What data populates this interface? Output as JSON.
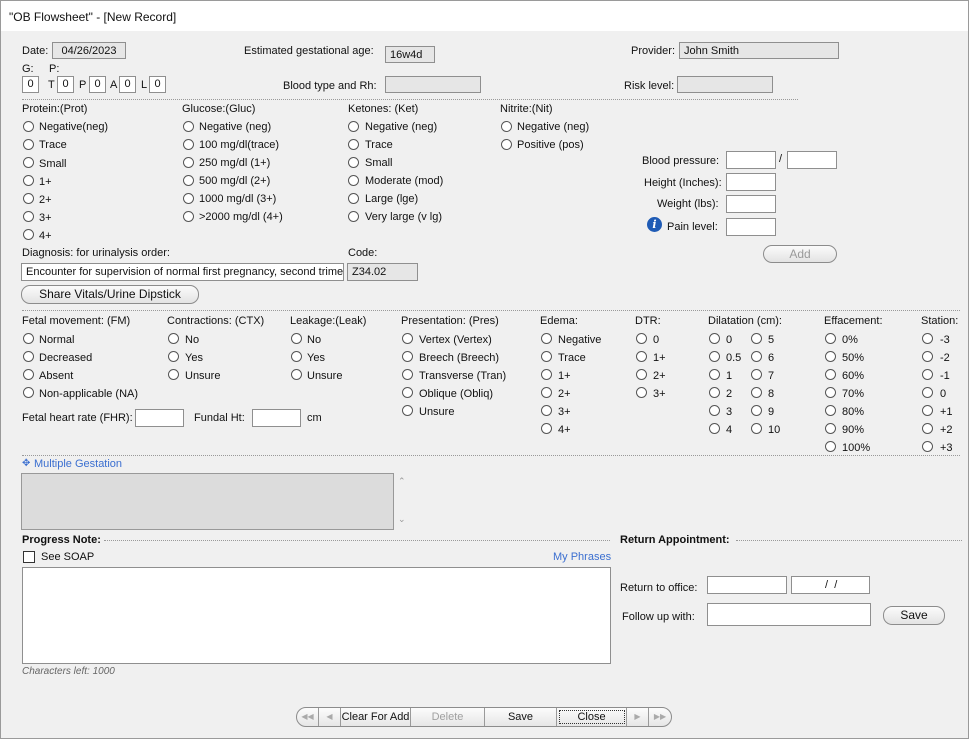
{
  "window": {
    "title": "\"OB Flowsheet\" - [New Record]"
  },
  "header": {
    "date_label": "Date:",
    "date_value": "04/26/2023",
    "ega_label": "Estimated gestational age:",
    "ega_value": "16w4d",
    "provider_label": "Provider:",
    "provider_value": "John Smith",
    "g_label": "G:",
    "g_value": "0",
    "p_label": "P:",
    "t_label": "T",
    "t_value": "0",
    "p2_label": "P",
    "p2_value": "0",
    "a_label": "A",
    "a_value": "0",
    "l_label": "L",
    "l_value": "0",
    "blood_type_label": "Blood type and Rh:",
    "risk_label": "Risk level:"
  },
  "urinalysis": {
    "protein": {
      "title": "Protein:(Prot)",
      "options": [
        "Negative(neg)",
        "Trace",
        "Small",
        "1+",
        "2+",
        "3+",
        "4+"
      ]
    },
    "glucose": {
      "title": "Glucose:(Gluc)",
      "options": [
        "Negative (neg)",
        "100 mg/dl(trace)",
        "250 mg/dl (1+)",
        "500 mg/dl (2+)",
        "1000 mg/dl (3+)",
        ">2000 mg/dl (4+)"
      ]
    },
    "ketones": {
      "title": "Ketones: (Ket)",
      "options": [
        "Negative (neg)",
        "Trace",
        "Small",
        "Moderate (mod)",
        "Large (lge)",
        "Very large (v lg)"
      ]
    },
    "nitrite": {
      "title": "Nitrite:(Nit)",
      "options": [
        "Negative (neg)",
        "Positive (pos)"
      ]
    }
  },
  "vitals": {
    "bp_label": "Blood pressure:",
    "bp_sep": "/",
    "height_label": "Height (Inches):",
    "weight_label": "Weight (lbs):",
    "pain_label": "Pain level:",
    "add_label": "Add"
  },
  "diagnosis": {
    "label": "Diagnosis: for urinalysis order:",
    "value": "Encounter for supervision of normal first pregnancy, second trimester",
    "code_label": "Code:",
    "code_value": "Z34.02",
    "share_label": "Share Vitals/Urine Dipstick"
  },
  "fetal": {
    "movement": {
      "title": "Fetal movement: (FM)",
      "options": [
        "Normal",
        "Decreased",
        "Absent",
        "Non-applicable (NA)"
      ]
    },
    "contractions": {
      "title": "Contractions: (CTX)",
      "options": [
        "No",
        "Yes",
        "Unsure"
      ]
    },
    "leakage": {
      "title": "Leakage:(Leak)",
      "options": [
        "No",
        "Yes",
        "Unsure"
      ]
    },
    "presentation": {
      "title": "Presentation: (Pres)",
      "options": [
        "Vertex (Vertex)",
        "Breech (Breech)",
        "Transverse (Tran)",
        "Oblique (Obliq)",
        "Unsure"
      ]
    },
    "edema": {
      "title": "Edema:",
      "options": [
        "Negative",
        "Trace",
        "1+",
        "2+",
        "3+",
        "4+"
      ]
    },
    "dtr": {
      "title": "DTR:",
      "options": [
        "0",
        "1+",
        "2+",
        "3+"
      ]
    },
    "dilatation": {
      "title": "Dilatation (cm):",
      "col1": [
        "0",
        "0.5",
        "1",
        "2",
        "3",
        "4"
      ],
      "col2": [
        "5",
        "6",
        "7",
        "8",
        "9",
        "10"
      ]
    },
    "effacement": {
      "title": "Effacement:",
      "options": [
        "0%",
        "50%",
        "60%",
        "70%",
        "80%",
        "90%",
        "100%"
      ]
    },
    "station": {
      "title": "Station:",
      "options": [
        "-3",
        "-2",
        "-1",
        "0",
        "+1",
        "+2",
        "+3"
      ]
    },
    "fhr_label": "Fetal heart rate (FHR):",
    "fundal_label": "Fundal Ht:",
    "fundal_unit": "cm"
  },
  "multiple_gestation": {
    "label": "Multiple Gestation"
  },
  "progress": {
    "title": "Progress Note:",
    "see_soap": "See SOAP",
    "my_phrases": "My Phrases",
    "chars_left": "Characters left: 1000"
  },
  "return_appt": {
    "title": "Return Appointment:",
    "return_label": "Return to office:",
    "date_placeholder": " /  /",
    "follow_label": "Follow up with:",
    "save_label": "Save"
  },
  "bottom_nav": {
    "clear_label": "Clear For Add",
    "delete_label": "Delete",
    "save_label": "Save",
    "close_label": "Close"
  }
}
